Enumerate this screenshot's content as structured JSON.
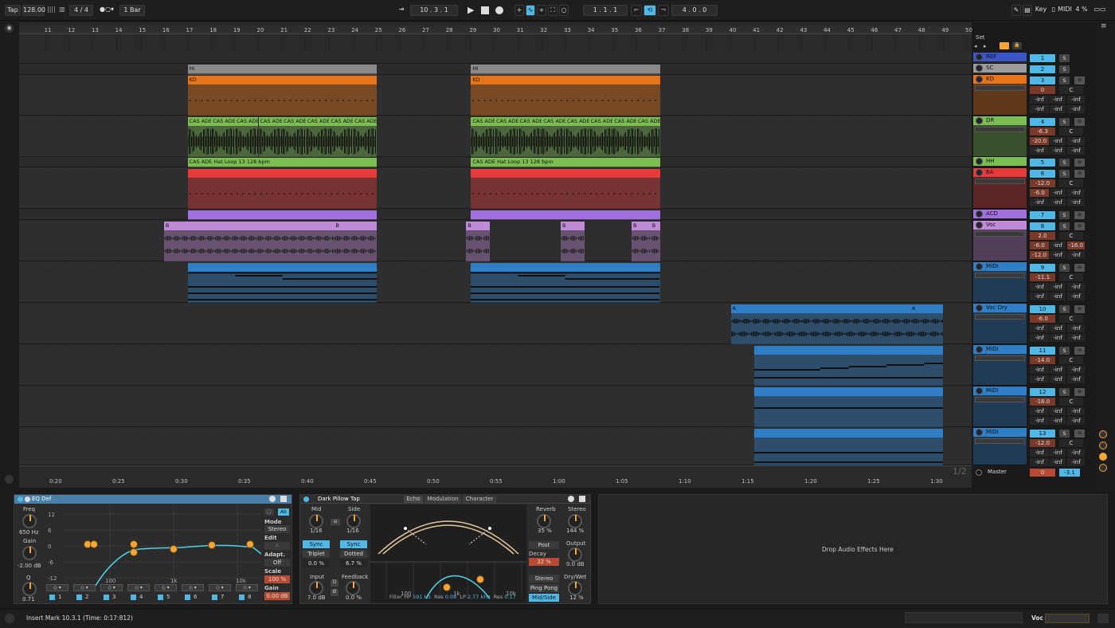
{
  "transport": {
    "tap": "Tap",
    "tempo": "128.00",
    "signature": "4 / 4",
    "quantize": "1 Bar",
    "position": "10 .   3 .   1",
    "loop_start": "1 .   1 .   1",
    "loop_length": "4 .   0 .   0",
    "key": "Key",
    "midi": "MIDI",
    "cpu": "4 %"
  },
  "bars": [
    "11",
    "12",
    "13",
    "14",
    "15",
    "16",
    "17",
    "18",
    "19",
    "20",
    "21",
    "22",
    "23",
    "24",
    "25",
    "26",
    "27",
    "28",
    "29",
    "30",
    "31",
    "32",
    "33",
    "34",
    "35",
    "36",
    "37",
    "38",
    "39",
    "40",
    "41",
    "42",
    "43",
    "44",
    "45",
    "46",
    "47",
    "48",
    "49",
    "50"
  ],
  "times": [
    "0:20",
    "0:25",
    "0:30",
    "0:35",
    "0:40",
    "0:45",
    "0:50",
    "0:55",
    "1:00",
    "1:05",
    "1:10",
    "1:15",
    "1:20",
    "1:25",
    "1:30"
  ],
  "set_label": "Set",
  "page_indicator": "1/2",
  "clip_labels": {
    "hi": "HI",
    "kd": "KD",
    "cas": "CAS ADE",
    "hat": "CAS ADE Hat Loop 13 128 bpm",
    "b": "B",
    "a": "A"
  },
  "tracks": [
    {
      "name": "REF",
      "color": "#3a55c8",
      "num": "1",
      "vol": "",
      "pan": "",
      "sa": "",
      "sb": "",
      "sc": ""
    },
    {
      "name": "SC",
      "color": "#9b9b9b",
      "num": "2",
      "vol": "",
      "pan": "",
      "sa": "",
      "sb": "",
      "sc": ""
    },
    {
      "name": "KD",
      "color": "#e87418",
      "num": "3",
      "vol": "0",
      "pan": "C",
      "sa": "-inf",
      "sb": "-inf",
      "sc": "-inf"
    },
    {
      "name": "DR",
      "color": "#7bbd52",
      "num": "4",
      "vol": "-6.3",
      "pan": "C",
      "sa": "-20.0",
      "sb": "-inf",
      "sc": "-inf"
    },
    {
      "name": "HH",
      "color": "#7bbd52",
      "num": "5",
      "vol": "",
      "pan": "",
      "sa": "",
      "sb": "",
      "sc": ""
    },
    {
      "name": "BA",
      "color": "#e53b3b",
      "num": "6",
      "vol": "-12.0",
      "pan": "C",
      "sa": "-6.0",
      "sb": "-inf",
      "sc": "-inf"
    },
    {
      "name": "ACD",
      "color": "#a070e0",
      "num": "7",
      "vol": "",
      "pan": "",
      "sa": "",
      "sb": "",
      "sc": ""
    },
    {
      "name": "Voc",
      "color": "#c08ad8",
      "num": "8",
      "vol": "2.0",
      "pan": "C",
      "sa": "-6.0",
      "sb": "-inf",
      "sc": "-16.0",
      "sd": "-12.0"
    },
    {
      "name": "MIDI",
      "color": "#2e7fc6",
      "num": "9",
      "vol": "-11.1",
      "pan": "C",
      "sa": "-inf",
      "sb": "-inf",
      "sc": "-inf"
    },
    {
      "name": "Voc Dry",
      "color": "#2e7fc6",
      "num": "10",
      "vol": "-6.0",
      "pan": "C",
      "sa": "-inf",
      "sb": "-inf",
      "sc": "-inf"
    },
    {
      "name": "MIDI",
      "color": "#2e7fc6",
      "num": "11",
      "vol": "-14.0",
      "pan": "C",
      "sa": "-inf",
      "sb": "-inf",
      "sc": "-inf"
    },
    {
      "name": "MIDI",
      "color": "#2e7fc6",
      "num": "12",
      "vol": "-18.0",
      "pan": "C",
      "sa": "-inf",
      "sb": "-inf",
      "sc": "-inf"
    },
    {
      "name": "MIDI",
      "color": "#2e7fc6",
      "num": "13",
      "vol": "-12.0",
      "pan": "C",
      "sa": "-inf",
      "sb": "-inf",
      "sc": "-inf"
    }
  ],
  "master": {
    "name": "Master",
    "vol": "0",
    "pan": "-3.1"
  },
  "eq": {
    "title": "EQ Def",
    "freq_label": "Freq",
    "freq": "650 Hz",
    "gain_label": "Gain",
    "gain": "-2.00 dB",
    "q_label": "Q",
    "q": "0.71",
    "mode_label": "Mode",
    "mode": "Stereo",
    "edit_label": "Edit",
    "edit_value": "A",
    "adapt_label": "Adapt. Q",
    "adapt": "Off",
    "scale_label": "Scale",
    "scale": "100 %",
    "out_gain_label": "Gain",
    "out_gain": "0.00 dB",
    "db_ticks": [
      "12",
      "6",
      "0",
      "-6",
      "-12"
    ],
    "freq_ticks": [
      "100",
      "1k",
      "10k"
    ],
    "bands": [
      "1",
      "2",
      "3",
      "4",
      "5",
      "6",
      "7",
      "8"
    ],
    "toggle_a": "A/B",
    "toggle_b": "Ab"
  },
  "echo": {
    "title": "Dark Pillow Tap",
    "tabs": [
      "Echo",
      "Modulation",
      "Character"
    ],
    "mid_label": "Mid",
    "mid": "1/16",
    "side_label": "Side",
    "side": "1/16",
    "sync": "Sync",
    "triplet": "Triplet",
    "dotted": "Dotted",
    "mid_offset": "0.0 %",
    "side_offset": "6.7 %",
    "input_label": "Input",
    "input": "7.0 dB",
    "feedback_label": "Feedback",
    "feedback": "0.0 %",
    "reverb_label": "Reverb",
    "reverb": "35 %",
    "stereo_label": "Stereo",
    "stereo": "144 %",
    "post": "Post",
    "decay_label": "Decay",
    "decay": "32 %",
    "output_label": "Output",
    "output": "0.0 dB",
    "drywet_label": "Dry/Wet",
    "drywet": "12 %",
    "stereo_btn": "Stereo",
    "pingpong": "Ping Pong",
    "midside": "Mid/Side",
    "filter": "Filter",
    "hp_label": "HP",
    "hp": "591 Hz",
    "res1_label": "Res",
    "res1": "0.08",
    "lp_label": "LP",
    "lp": "2.77 kHz",
    "res2_label": "Res",
    "res2": "0.17",
    "freq_ticks": [
      "100",
      "1k",
      "10k"
    ],
    "ab_d": "D",
    "ab_link": "Ø"
  },
  "drop_text": "Drop Audio Effects Here",
  "status": "Insert Mark 10.3.1 (Time: 0:17:812)",
  "status_track": "Voc"
}
